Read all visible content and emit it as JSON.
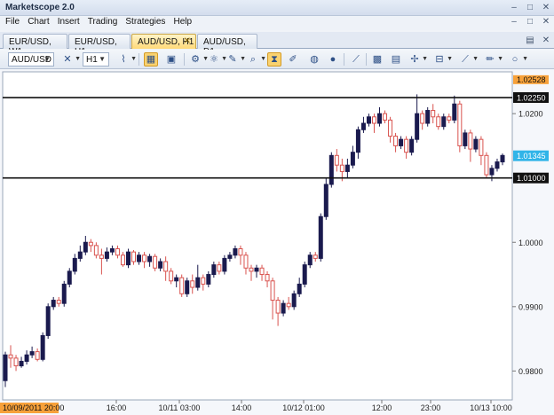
{
  "window": {
    "title": "Marketscope 2.0",
    "controls": [
      "–",
      "□",
      "✕"
    ]
  },
  "menu": [
    "File",
    "Chart",
    "Insert",
    "Trading",
    "Strategies",
    "Help"
  ],
  "menu_controls": [
    "–",
    "□",
    "✕"
  ],
  "tabs": [
    {
      "label": "EUR/USD, W1",
      "active": false
    },
    {
      "label": "EUR/USD, H1",
      "active": false
    },
    {
      "label": "AUD/USD, H1",
      "active": true
    },
    {
      "label": "AUD/USD, D1",
      "active": false
    }
  ],
  "tab_close": "✕",
  "tab_controls": [
    "▤",
    "✕"
  ],
  "toolbar": {
    "instrument": "AUD/USD",
    "timeframe": "H1",
    "icons": [
      "candle-style-icon",
      "line-chart-icon",
      "chart-fit-icon",
      "screenshot-icon",
      "indicator-icon",
      "oscillator-icon",
      "signal-icon",
      "zoom-icon",
      "hourglass-icon",
      "brush-icon",
      "globe-icon",
      "ruler-icon",
      "image-icon",
      "table-icon",
      "crosshair-icon",
      "horizontal-line-icon",
      "trend-line-icon",
      "pen-icon",
      "ellipse-icon"
    ]
  },
  "colors": {
    "bull_candle": "#1a1a4e",
    "bear_candle": "#d9534f",
    "background": "#ffffff",
    "level_line": "#111111",
    "price_marker": "#30b4e8",
    "time_marker": "#f7a13a"
  },
  "chart_data": {
    "type": "candlestick",
    "instrument": "AUD/USD",
    "timeframe": "H1",
    "ylim": [
      0.9755,
      1.0265
    ],
    "y_ticks": [
      "1.0200",
      "1.0000",
      "0.9900",
      "0.9800"
    ],
    "x_ticks": [
      "16:00",
      "10/11 03:00",
      "14:00",
      "10/12 01:00",
      "12:00",
      "23:00",
      "10/13 10:00"
    ],
    "cursor_time": "10/09/2011 20:00",
    "levels": [
      {
        "label": "1.02250",
        "value": 1.0225
      },
      {
        "label": "1.01000",
        "value": 1.01
      }
    ],
    "top_label": "1.02528",
    "top_value": 1.02528,
    "current_price": {
      "label": "1.01345",
      "value": 1.01345
    },
    "candles": [
      [
        0.9785,
        0.9825,
        0.9775,
        0.983
      ],
      [
        0.9825,
        0.982,
        0.9805,
        0.984
      ],
      [
        0.982,
        0.9808,
        0.98,
        0.9825
      ],
      [
        0.9808,
        0.9815,
        0.9805,
        0.9822
      ],
      [
        0.9815,
        0.9825,
        0.981,
        0.9832
      ],
      [
        0.9825,
        0.983,
        0.982,
        0.9838
      ],
      [
        0.983,
        0.9818,
        0.9815,
        0.9835
      ],
      [
        0.9818,
        0.9855,
        0.9815,
        0.986
      ],
      [
        0.9855,
        0.99,
        0.985,
        0.9905
      ],
      [
        0.99,
        0.991,
        0.9895,
        0.9915
      ],
      [
        0.991,
        0.9905,
        0.99,
        0.9915
      ],
      [
        0.9905,
        0.9935,
        0.99,
        0.994
      ],
      [
        0.9935,
        0.9955,
        0.993,
        0.996
      ],
      [
        0.9955,
        0.9975,
        0.995,
        0.9982
      ],
      [
        0.9975,
        0.9985,
        0.997,
        0.9995
      ],
      [
        0.9985,
        1.0,
        0.998,
        1.001
      ],
      [
        1.0,
        0.9995,
        0.9985,
        1.0005
      ],
      [
        0.9995,
        0.998,
        0.9975,
        1.0
      ],
      [
        0.998,
        0.9975,
        0.995,
        0.999
      ],
      [
        0.9975,
        0.9985,
        0.997,
        0.9992
      ],
      [
        0.9985,
        0.999,
        0.998,
        0.9995
      ],
      [
        0.999,
        0.998,
        0.9975,
        0.9995
      ],
      [
        0.998,
        0.9965,
        0.9962,
        0.9985
      ],
      [
        0.9965,
        0.9985,
        0.996,
        0.999
      ],
      [
        0.9985,
        0.997,
        0.9965,
        0.9988
      ],
      [
        0.997,
        0.998,
        0.9965,
        0.9985
      ],
      [
        0.998,
        0.997,
        0.996,
        0.9985
      ],
      [
        0.997,
        0.9978,
        0.9962,
        0.9982
      ],
      [
        0.9978,
        0.996,
        0.9955,
        0.9982
      ],
      [
        0.996,
        0.997,
        0.9955,
        0.9975
      ],
      [
        0.997,
        0.9955,
        0.994,
        0.9978
      ],
      [
        0.9955,
        0.994,
        0.9935,
        0.996
      ],
      [
        0.994,
        0.9945,
        0.993,
        0.995
      ],
      [
        0.9945,
        0.992,
        0.9915,
        0.995
      ],
      [
        0.992,
        0.994,
        0.9915,
        0.9945
      ],
      [
        0.994,
        0.993,
        0.992,
        0.995
      ],
      [
        0.993,
        0.9945,
        0.9925,
        0.9965
      ],
      [
        0.9945,
        0.9935,
        0.9925,
        0.995
      ],
      [
        0.9935,
        0.995,
        0.993,
        0.9955
      ],
      [
        0.995,
        0.9965,
        0.9945,
        0.997
      ],
      [
        0.9965,
        0.9955,
        0.995,
        0.997
      ],
      [
        0.9955,
        0.9975,
        0.995,
        0.998
      ],
      [
        0.9975,
        0.998,
        0.997,
        0.9985
      ],
      [
        0.998,
        0.999,
        0.9975,
        0.9995
      ],
      [
        0.999,
        0.998,
        0.9965,
        0.9995
      ],
      [
        0.998,
        0.996,
        0.995,
        0.9985
      ],
      [
        0.996,
        0.9955,
        0.994,
        0.9965
      ],
      [
        0.9955,
        0.996,
        0.9945,
        0.9965
      ],
      [
        0.996,
        0.995,
        0.994,
        0.9965
      ],
      [
        0.995,
        0.994,
        0.993,
        0.9955
      ],
      [
        0.994,
        0.991,
        0.988,
        0.9945
      ],
      [
        0.991,
        0.989,
        0.987,
        0.9915
      ],
      [
        0.989,
        0.9905,
        0.9885,
        0.991
      ],
      [
        0.9905,
        0.99,
        0.9895,
        0.9915
      ],
      [
        0.99,
        0.992,
        0.9895,
        0.9925
      ],
      [
        0.992,
        0.9935,
        0.9915,
        0.9945
      ],
      [
        0.9935,
        0.9965,
        0.993,
        0.997
      ],
      [
        0.9965,
        0.998,
        0.996,
        0.9985
      ],
      [
        0.998,
        0.9975,
        0.997,
        0.9985
      ],
      [
        0.9975,
        1.004,
        0.997,
        1.0045
      ],
      [
        1.004,
        1.009,
        1.0035,
        1.01
      ],
      [
        1.009,
        1.0135,
        1.0085,
        1.014
      ],
      [
        1.0135,
        1.012,
        1.011,
        1.0145
      ],
      [
        1.012,
        1.011,
        1.0095,
        1.013
      ],
      [
        1.011,
        1.012,
        1.01,
        1.013
      ],
      [
        1.012,
        1.014,
        1.0115,
        1.015
      ],
      [
        1.014,
        1.0175,
        1.013,
        1.018
      ],
      [
        1.0175,
        1.0185,
        1.017,
        1.0195
      ],
      [
        1.0185,
        1.0195,
        1.018,
        1.02
      ],
      [
        1.0195,
        1.0185,
        1.017,
        1.02
      ],
      [
        1.0185,
        1.02,
        1.018,
        1.021
      ],
      [
        1.02,
        1.019,
        1.0185,
        1.0205
      ],
      [
        1.019,
        1.0165,
        1.0155,
        1.0195
      ],
      [
        1.0165,
        1.015,
        1.014,
        1.017
      ],
      [
        1.015,
        1.016,
        1.0145,
        1.0165
      ],
      [
        1.016,
        1.014,
        1.013,
        1.0165
      ],
      [
        1.014,
        1.016,
        1.0135,
        1.0165
      ],
      [
        1.016,
        1.02,
        1.0155,
        1.023
      ],
      [
        1.02,
        1.0185,
        1.0175,
        1.0205
      ],
      [
        1.0185,
        1.0205,
        1.018,
        1.021
      ],
      [
        1.0205,
        1.0195,
        1.0185,
        1.0215
      ],
      [
        1.0195,
        1.018,
        1.0175,
        1.02
      ],
      [
        1.018,
        1.0195,
        1.0175,
        1.02
      ],
      [
        1.0195,
        1.019,
        1.0185,
        1.02
      ],
      [
        1.019,
        1.0215,
        1.0185,
        1.0228
      ],
      [
        1.0215,
        1.015,
        1.014,
        1.022
      ],
      [
        1.015,
        1.017,
        1.0145,
        1.0175
      ],
      [
        1.017,
        1.0145,
        1.0125,
        1.0175
      ],
      [
        1.0145,
        1.016,
        1.014,
        1.0165
      ],
      [
        1.016,
        1.0135,
        1.012,
        1.0165
      ],
      [
        1.0135,
        1.0105,
        1.01,
        1.014
      ],
      [
        1.0105,
        1.0115,
        1.0095,
        1.012
      ],
      [
        1.0115,
        1.0125,
        1.011,
        1.013
      ],
      [
        1.0125,
        1.0135,
        1.012,
        1.0138
      ]
    ]
  }
}
